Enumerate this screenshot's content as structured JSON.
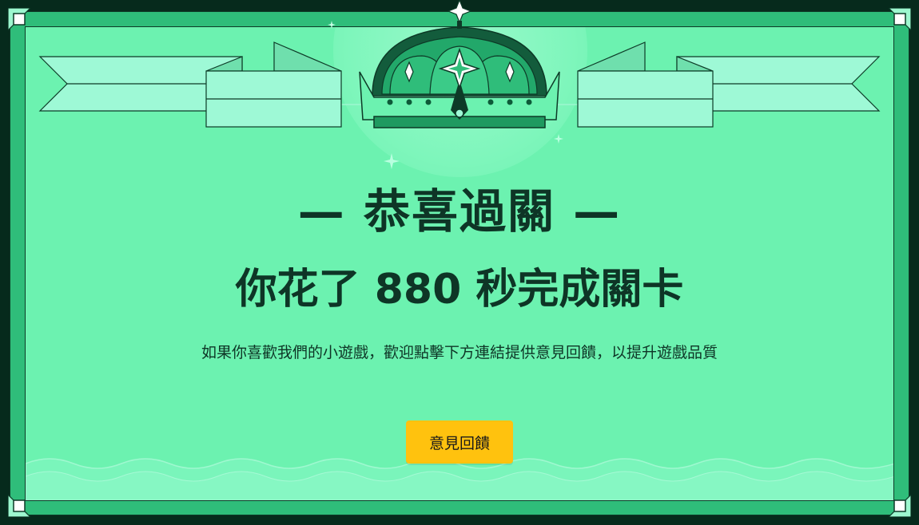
{
  "title": "— 恭喜過關 —",
  "result": {
    "prefix": "你花了",
    "seconds": "880",
    "suffix": "秒完成關卡"
  },
  "message": "如果你喜歡我們的小遊戲，歡迎點擊下方連結提供意見回饋，以提升遊戲品質",
  "feedback_button": {
    "label": "意見回饋"
  },
  "decorations": {
    "badge_icon": "crown-icon",
    "ribbon_icon": "banner-ribbon",
    "corner_icon": "square-corner-ornament"
  },
  "colors": {
    "panel": "#6cf2b0",
    "border": "#2fbd7a",
    "dark": "#0e3526",
    "button": "#ffc20e"
  }
}
